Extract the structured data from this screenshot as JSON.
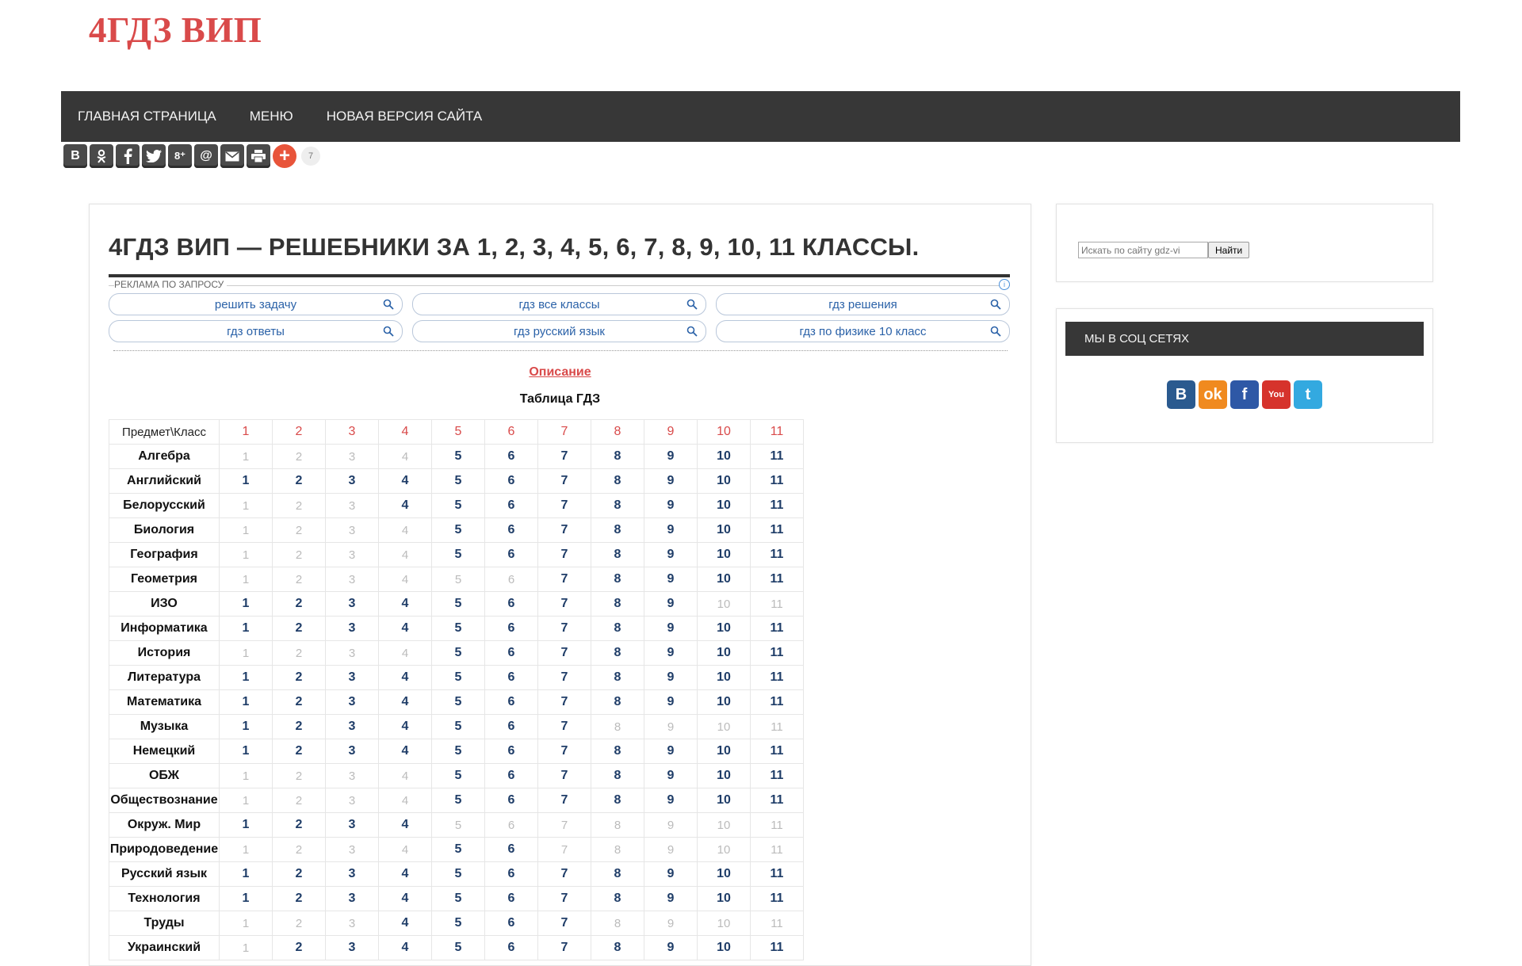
{
  "site": {
    "logo": "4ГДЗ ВИП"
  },
  "nav": {
    "items": [
      "ГЛАВНАЯ СТРАНИЦА",
      "МЕНЮ",
      "НОВАЯ ВЕРСИЯ САЙТА"
    ]
  },
  "share": {
    "buttons": [
      "В",
      "ok-icon",
      "f",
      "twitter-icon",
      "g+",
      "@",
      "mail-icon",
      "print-icon",
      "+"
    ],
    "labels": {
      "vk": "В",
      "gplus": "8⁺",
      "mailru": "@",
      "plus": "+"
    },
    "count": "7"
  },
  "main": {
    "title": "4ГДЗ ВИП — РЕШЕБНИКИ ЗА 1, 2, 3, 4, 5, 6, 7, 8, 9, 10, 11 КЛАССЫ.",
    "ad": {
      "label": "РЕКЛАМА ПО ЗАПРОСУ",
      "info": "i",
      "links": [
        "решить задачу",
        "гдз все классы",
        "гдз решения",
        "гдз ответы",
        "гдз русский язык",
        "гдз по физике 10 класс"
      ]
    },
    "description_link": "Описание",
    "table_caption": "Таблица ГДЗ",
    "table": {
      "corner": "Предмет\\Класс",
      "grades": [
        "1",
        "2",
        "3",
        "4",
        "5",
        "6",
        "7",
        "8",
        "9",
        "10",
        "11"
      ],
      "rows": [
        {
          "subject": "Алгебра",
          "available": [
            0,
            0,
            0,
            0,
            1,
            1,
            1,
            1,
            1,
            1,
            1
          ]
        },
        {
          "subject": "Английский",
          "available": [
            1,
            1,
            1,
            1,
            1,
            1,
            1,
            1,
            1,
            1,
            1
          ]
        },
        {
          "subject": "Белорусский",
          "available": [
            0,
            0,
            0,
            1,
            1,
            1,
            1,
            1,
            1,
            1,
            1
          ]
        },
        {
          "subject": "Биология",
          "available": [
            0,
            0,
            0,
            0,
            1,
            1,
            1,
            1,
            1,
            1,
            1
          ]
        },
        {
          "subject": "География",
          "available": [
            0,
            0,
            0,
            0,
            1,
            1,
            1,
            1,
            1,
            1,
            1
          ]
        },
        {
          "subject": "Геометрия",
          "available": [
            0,
            0,
            0,
            0,
            0,
            0,
            1,
            1,
            1,
            1,
            1
          ]
        },
        {
          "subject": "ИЗО",
          "available": [
            1,
            1,
            1,
            1,
            1,
            1,
            1,
            1,
            1,
            0,
            0
          ]
        },
        {
          "subject": "Информатика",
          "available": [
            1,
            1,
            1,
            1,
            1,
            1,
            1,
            1,
            1,
            1,
            1
          ]
        },
        {
          "subject": "История",
          "available": [
            0,
            0,
            0,
            0,
            1,
            1,
            1,
            1,
            1,
            1,
            1
          ]
        },
        {
          "subject": "Литература",
          "available": [
            1,
            1,
            1,
            1,
            1,
            1,
            1,
            1,
            1,
            1,
            1
          ]
        },
        {
          "subject": "Математика",
          "available": [
            1,
            1,
            1,
            1,
            1,
            1,
            1,
            1,
            1,
            1,
            1
          ]
        },
        {
          "subject": "Музыка",
          "available": [
            1,
            1,
            1,
            1,
            1,
            1,
            1,
            0,
            0,
            0,
            0
          ]
        },
        {
          "subject": "Немецкий",
          "available": [
            1,
            1,
            1,
            1,
            1,
            1,
            1,
            1,
            1,
            1,
            1
          ]
        },
        {
          "subject": "ОБЖ",
          "available": [
            0,
            0,
            0,
            0,
            1,
            1,
            1,
            1,
            1,
            1,
            1
          ]
        },
        {
          "subject": "Обществознание",
          "available": [
            0,
            0,
            0,
            0,
            1,
            1,
            1,
            1,
            1,
            1,
            1
          ]
        },
        {
          "subject": "Окруж. Мир",
          "available": [
            1,
            1,
            1,
            1,
            0,
            0,
            0,
            0,
            0,
            0,
            0
          ]
        },
        {
          "subject": "Природоведение",
          "available": [
            0,
            0,
            0,
            0,
            1,
            1,
            0,
            0,
            0,
            0,
            0
          ]
        },
        {
          "subject": "Русский язык",
          "available": [
            1,
            1,
            1,
            1,
            1,
            1,
            1,
            1,
            1,
            1,
            1
          ]
        },
        {
          "subject": "Технология",
          "available": [
            1,
            1,
            1,
            1,
            1,
            1,
            1,
            1,
            1,
            1,
            1
          ]
        },
        {
          "subject": "Труды",
          "available": [
            0,
            0,
            0,
            1,
            1,
            1,
            1,
            0,
            0,
            0,
            0
          ]
        },
        {
          "subject": "Украинский",
          "available": [
            0,
            1,
            1,
            1,
            1,
            1,
            1,
            1,
            1,
            1,
            1
          ]
        }
      ]
    }
  },
  "sidebar": {
    "search": {
      "placeholder": "Искать по сайту gdz-vi",
      "button": "Найти"
    },
    "social": {
      "title": "МЫ В СОЦ СЕТЯХ",
      "icons": [
        {
          "name": "vk-icon",
          "label": "В",
          "color": "#2a5a8f"
        },
        {
          "name": "ok-icon",
          "label": "ok",
          "color": "#f08a1f"
        },
        {
          "name": "facebook-icon",
          "label": "f",
          "color": "#2e58a6"
        },
        {
          "name": "youtube-icon",
          "label": "You",
          "color": "#d6332c"
        },
        {
          "name": "twitter-icon",
          "label": "t",
          "color": "#33a9e0"
        }
      ]
    }
  },
  "colors": {
    "accent": "#d94a4a",
    "nav_bg": "#373737",
    "available": "#1f3d68",
    "unavailable": "#bbbbbb",
    "ad_text": "#2b62a8"
  }
}
